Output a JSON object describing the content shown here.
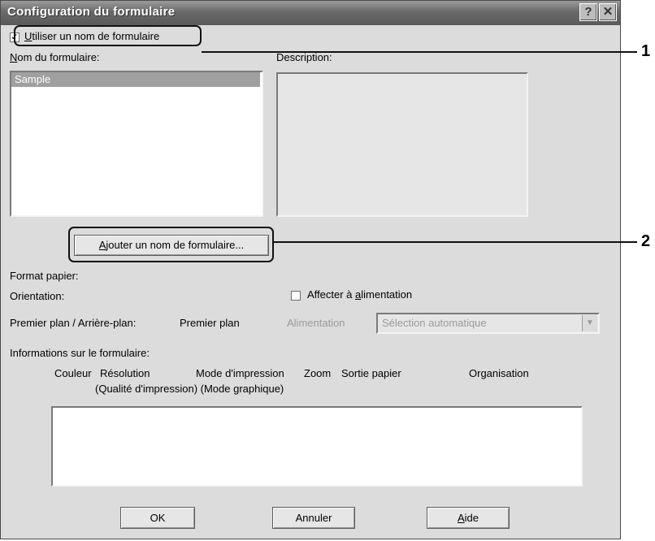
{
  "window": {
    "title": "Configuration du formulaire"
  },
  "titlebar": {
    "help_label": "?",
    "close_label": "✕"
  },
  "use_form_name": {
    "checked": true,
    "check_glyph": "✓",
    "label_first": "U",
    "label_rest": "tiliser un nom de formulaire"
  },
  "form_name": {
    "label_first": "N",
    "label_rest": "om du formulaire:",
    "items": [
      "Sample"
    ],
    "selected": "Sample"
  },
  "description": {
    "label": "Description:"
  },
  "add_button": {
    "label_first": "A",
    "label_rest": "jouter un nom de formulaire..."
  },
  "format_papier": {
    "label": "Format papier:"
  },
  "orientation": {
    "label": "Orientation:"
  },
  "assign_feed": {
    "checked": false,
    "label_pre": "Affecter à ",
    "label_ul": "a",
    "label_post": "limentation"
  },
  "foreground": {
    "label": "Premier plan / Arrière-plan:",
    "value": "Premier plan"
  },
  "alimentation": {
    "label": "Alimentation",
    "value": "Sélection automatique",
    "arrow": "▼"
  },
  "info": {
    "label": "Informations sur le formulaire:",
    "columns": [
      "Couleur",
      "Résolution",
      "Mode d'impression",
      "Zoom",
      "Sortie papier",
      "Organisation"
    ],
    "sub_row": "(Qualité d'impression) (Mode graphique)"
  },
  "buttons": {
    "ok": "OK",
    "cancel": "Annuler",
    "help_first": "A",
    "help_rest": "ide"
  },
  "callouts": [
    "1",
    "2"
  ],
  "colors": {
    "titlebar": "#6a6a6a",
    "face": "#dcdcdc",
    "selection": "#a0a0a0"
  }
}
